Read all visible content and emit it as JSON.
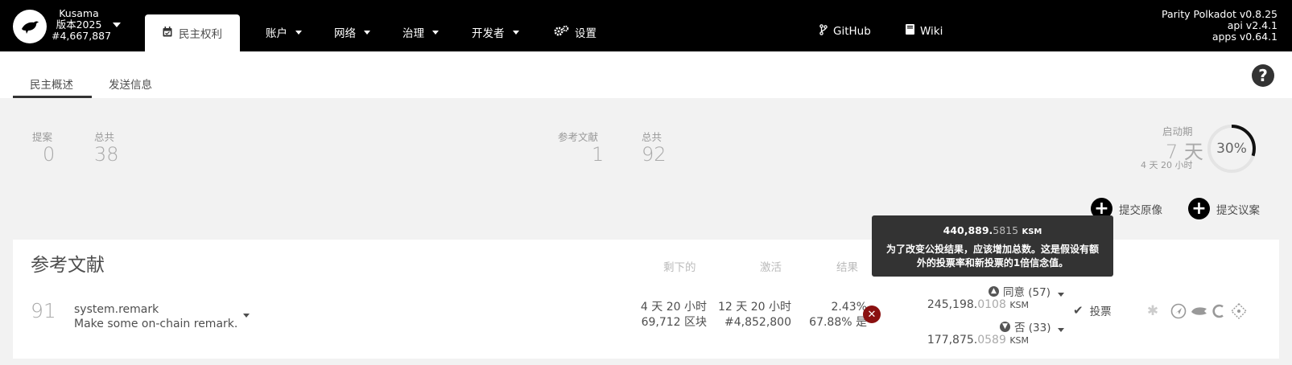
{
  "header": {
    "chain_name": "Kusama",
    "chain_version": "版本2025",
    "chain_block": "#4,667,887",
    "nav": {
      "democracy": "民主权利",
      "accounts": "账户",
      "network": "网络",
      "governance": "治理",
      "developer": "开发者",
      "settings": "设置",
      "github": "GitHub",
      "wiki": "Wiki"
    },
    "versions": {
      "client": "Parity Polkadot v0.8.25",
      "api": "api v2.4.1",
      "apps": "apps v0.64.1"
    }
  },
  "subtabs": {
    "overview": "民主概述",
    "dispatch": "发送信息"
  },
  "summary": {
    "proposals_label": "提案",
    "proposals_value": "0",
    "proposals_total_label": "总共",
    "proposals_total_value": "38",
    "referenda_label": "参考文献",
    "referenda_value": "1",
    "referenda_total_label": "总共",
    "referenda_total_value": "92",
    "launch_label": "启动期",
    "launch_value": "7 天",
    "launch_remaining": "4 天 20 小时",
    "launch_percent": "30%",
    "launch_fraction": 0.3
  },
  "actions": {
    "submit_preimage": "提交原像",
    "submit_proposal": "提交议案"
  },
  "referenda": {
    "title": "参考文献",
    "columns": {
      "remaining": "剩下的",
      "activate": "激活",
      "result": "结果"
    },
    "row": {
      "index": "91",
      "method": "system.remark",
      "description": "Make some on-chain remark.",
      "remaining_time": "4 天 20 小时",
      "remaining_blocks": "69,712 区块",
      "activate_time": "12 天 20 小时",
      "activate_block": "#4,852,800",
      "turnout": "2.43%",
      "aye_percent": "67.88% 是",
      "aye_label": "同意 (57)",
      "aye_amount_int": "245,198.",
      "aye_amount_frac": "0108",
      "nay_label": "否 (33)",
      "nay_amount_int": "177,875.",
      "nay_amount_frac": "0589",
      "unit": "KSM",
      "vote_button": "投票"
    }
  },
  "tooltip": {
    "amount_int": "440,889.",
    "amount_frac": "5815",
    "unit": "KSM",
    "text": "为了改变公投结果，应该增加总数。这是假设有额外的投票率和新投票的1倍信念值。"
  },
  "colors": {
    "topbar": "#000000",
    "reject_badge": "#8a1010",
    "text": "#4e4e4e"
  }
}
